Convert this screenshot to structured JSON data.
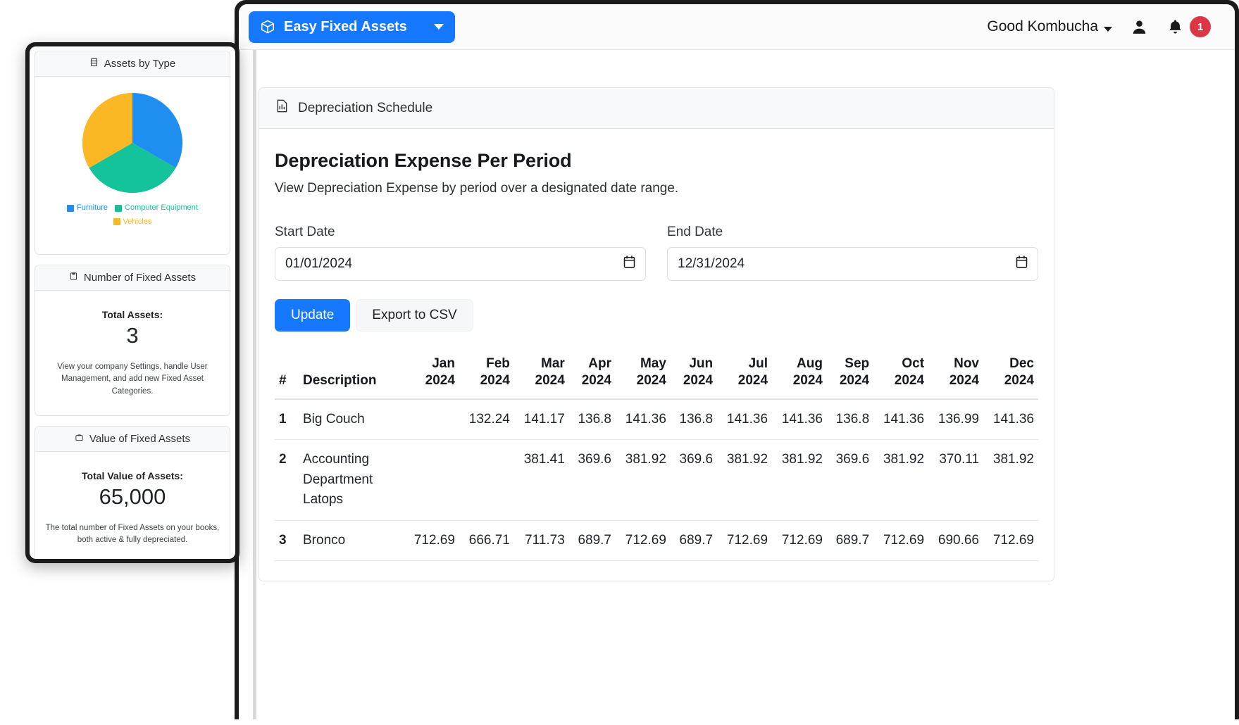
{
  "navbar": {
    "brand_label": "Easy Fixed Assets",
    "brand_icon": "cube-icon",
    "brand_caret_icon": "caret-down-icon",
    "org_label": "Good Kombucha",
    "org_caret_icon": "caret-down-icon",
    "user_icon": "user-icon",
    "bell_icon": "bell-icon",
    "notification_count": "1",
    "brand_color": "#1677ff",
    "badge_color": "#dc3545"
  },
  "sidebar": {
    "cards": [
      {
        "title": "Assets by Type",
        "icon": "database-icon"
      },
      {
        "title": "Number of Fixed Assets",
        "icon": "clipboard-icon",
        "stat_label": "Total Assets:",
        "stat_value": "3",
        "note": "View your company Settings, handle User Management, and add new Fixed Asset Categories."
      },
      {
        "title": "Value of Fixed Assets",
        "icon": "briefcase-icon",
        "stat_label": "Total Value of Assets:",
        "stat_value": "65,000",
        "note": "The total number of Fixed Assets on your books, both active & fully depreciated."
      }
    ]
  },
  "chart_data": {
    "type": "pie",
    "title": "Assets by Type",
    "legend_position": "bottom",
    "categories": [
      "Furniture",
      "Computer Equipment",
      "Vehicles"
    ],
    "values": [
      33.3,
      33.3,
      33.3
    ],
    "colors": [
      "#1f8ef1",
      "#15c39a",
      "#fbb724"
    ]
  },
  "panel": {
    "header_icon": "bar-chart-document-icon",
    "header_title": "Depreciation Schedule",
    "report_title": "Depreciation Expense Per Period",
    "report_subtitle": "View Depreciation Expense by period over a designated date range."
  },
  "form": {
    "start_date": {
      "label": "Start Date",
      "value": "01/01/2024",
      "icon": "calendar-icon"
    },
    "end_date": {
      "label": "End Date",
      "value": "12/31/2024",
      "icon": "calendar-icon"
    },
    "update_button": "Update",
    "export_button": "Export to CSV"
  },
  "table": {
    "headers": [
      "#",
      "Description",
      "Jan\n2024",
      "Feb\n2024",
      "Mar\n2024",
      "Apr\n2024",
      "May\n2024",
      "Jun\n2024",
      "Jul\n2024",
      "Aug\n2024",
      "Sep\n2024",
      "Oct\n2024",
      "Nov\n2024",
      "Dec\n2024"
    ],
    "rows": [
      {
        "index": "1",
        "description": "Big Couch",
        "values": [
          "",
          "132.24",
          "141.17",
          "136.8",
          "141.36",
          "136.8",
          "141.36",
          "141.36",
          "136.8",
          "141.36",
          "136.99",
          "141.36"
        ]
      },
      {
        "index": "2",
        "description": "Accounting Department Latops",
        "values": [
          "",
          "",
          "381.41",
          "369.6",
          "381.92",
          "369.6",
          "381.92",
          "381.92",
          "369.6",
          "381.92",
          "370.11",
          "381.92"
        ]
      },
      {
        "index": "3",
        "description": "Bronco",
        "values": [
          "712.69",
          "666.71",
          "711.73",
          "689.7",
          "712.69",
          "689.7",
          "712.69",
          "712.69",
          "689.7",
          "712.69",
          "690.66",
          "712.69"
        ]
      }
    ]
  }
}
